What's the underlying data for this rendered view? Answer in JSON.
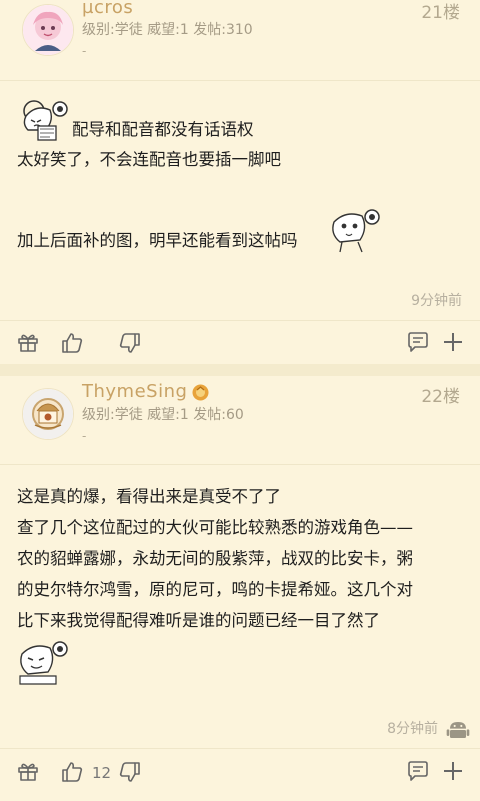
{
  "posts": [
    {
      "username": "µcros",
      "meta": "级别:学徒  威望:1  发帖:310",
      "dash": "-",
      "floor": "21楼",
      "lines": [
        "配导和配音都没有话语权",
        "太好笑了，不会连配音也要插一脚吧",
        "",
        "加上后面补的图，明早还能看到这帖吗"
      ],
      "time": "9分钟前",
      "like_count": ""
    },
    {
      "username": "ThymeSing",
      "meta": "级别:学徒  威望:1  发帖:60",
      "dash": "-",
      "floor": "22楼",
      "lines": [
        "这是真的爆，看得出来是真受不了了",
        "查了几个这位配过的大伙可能比较熟悉的游戏角色——",
        "农的貂蝉露娜，永劫无间的殷紫萍，战双的比安卡，粥",
        "的史尔特尔鸿雪，原的尼可，鸣的卡提希娅。这几个对",
        "比下来我觉得配得难听是谁的问题已经一目了然了"
      ],
      "time": "8分钟前",
      "like_count": "12"
    }
  ],
  "icons": {
    "gift": "gift-icon",
    "like": "thumbs-up-icon",
    "dislike": "thumbs-down-icon",
    "comment": "comment-icon",
    "add": "plus-icon",
    "device": "android-icon"
  },
  "colors": {
    "username": "#c8a265",
    "meta": "#a59b86",
    "background": "#fcf4dc"
  }
}
